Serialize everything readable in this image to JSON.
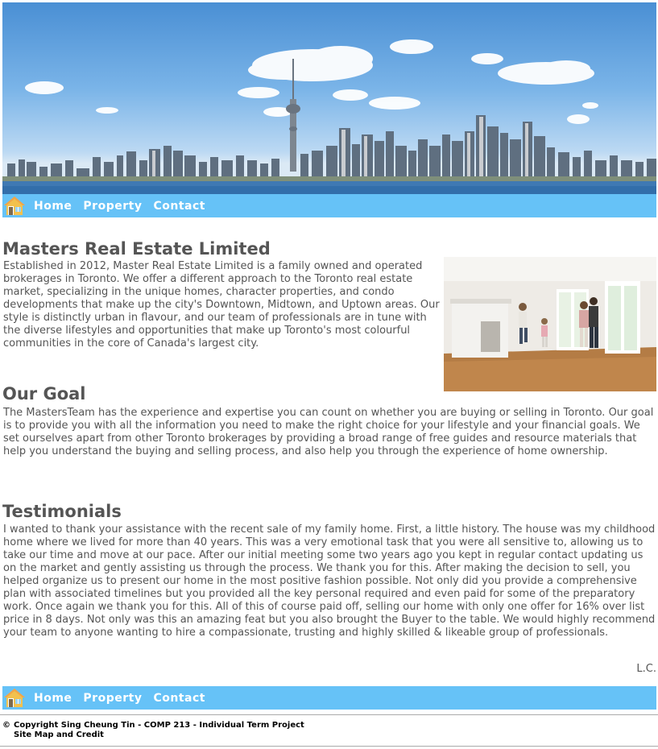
{
  "nav": {
    "links": [
      {
        "label": "Home"
      },
      {
        "label": "Property"
      },
      {
        "label": "Contact"
      }
    ]
  },
  "intro": {
    "title": "Masters Real Estate Limited",
    "body": "Established in 2012, Master Real Estate Limited is a family owned and operated brokerages in Toronto. We offer a different approach to the Toronto real estate market, specializing in the unique homes, character properties, and condo developments that make up the city's Downtown, Midtown, and Uptown areas. Our style is distinctly urban in flavour, and our team of professionals are in tune with the diverse lifestyles and opportunities that make up Toronto's most colourful communities in the core of Canada's largest city."
  },
  "goal": {
    "title": "Our Goal",
    "body": "The MastersTeam has the experience and expertise you can count on whether you are buying or selling in Toronto. Our goal is to provide you with all the information you need to make the right choice for your lifestyle and your financial goals. We set ourselves apart from other Toronto brokerages by providing a broad range of free guides and resource materials that help you understand the buying and selling process, and also help you through the experience of home ownership."
  },
  "testimonials": {
    "title": "Testimonials",
    "body": "I wanted to thank your assistance with the recent sale of my family home. First, a little history. The house was my childhood home where we lived for more than 40 years. This was a very emotional task that you were all sensitive to, allowing us to take our time and move at our pace. After our initial meeting some two years ago you kept in regular contact updating us on the market and gently assisting us through the process. We thank you for this. After making the decision to sell, you helped organize us to present our home in the most positive fashion possible. Not only did you provide a comprehensive plan with associated timelines but you provided all the key personal required and even paid for some of the preparatory work. Once again we thank you for this. All of this of course paid off, selling our home with only one offer for 16% over list price in 8 days. Not only was this an amazing feat but you also brought the Buyer to the table. We would highly recommend your team to anyone wanting to hire a compassionate, trusting and highly skilled & likeable group of professionals.",
    "signature": "L.C."
  },
  "footer": {
    "copyright_symbol": "©",
    "copyright": "Copyright Sing Cheung Tin - COMP 213 - Individual Term Project",
    "sitemap": "Site Map and Credit"
  },
  "colors": {
    "nav_bg": "#66c2f7",
    "text": "#555555",
    "nav_text": "#ffffff"
  },
  "icons": {
    "nav_home": "house-icon"
  }
}
